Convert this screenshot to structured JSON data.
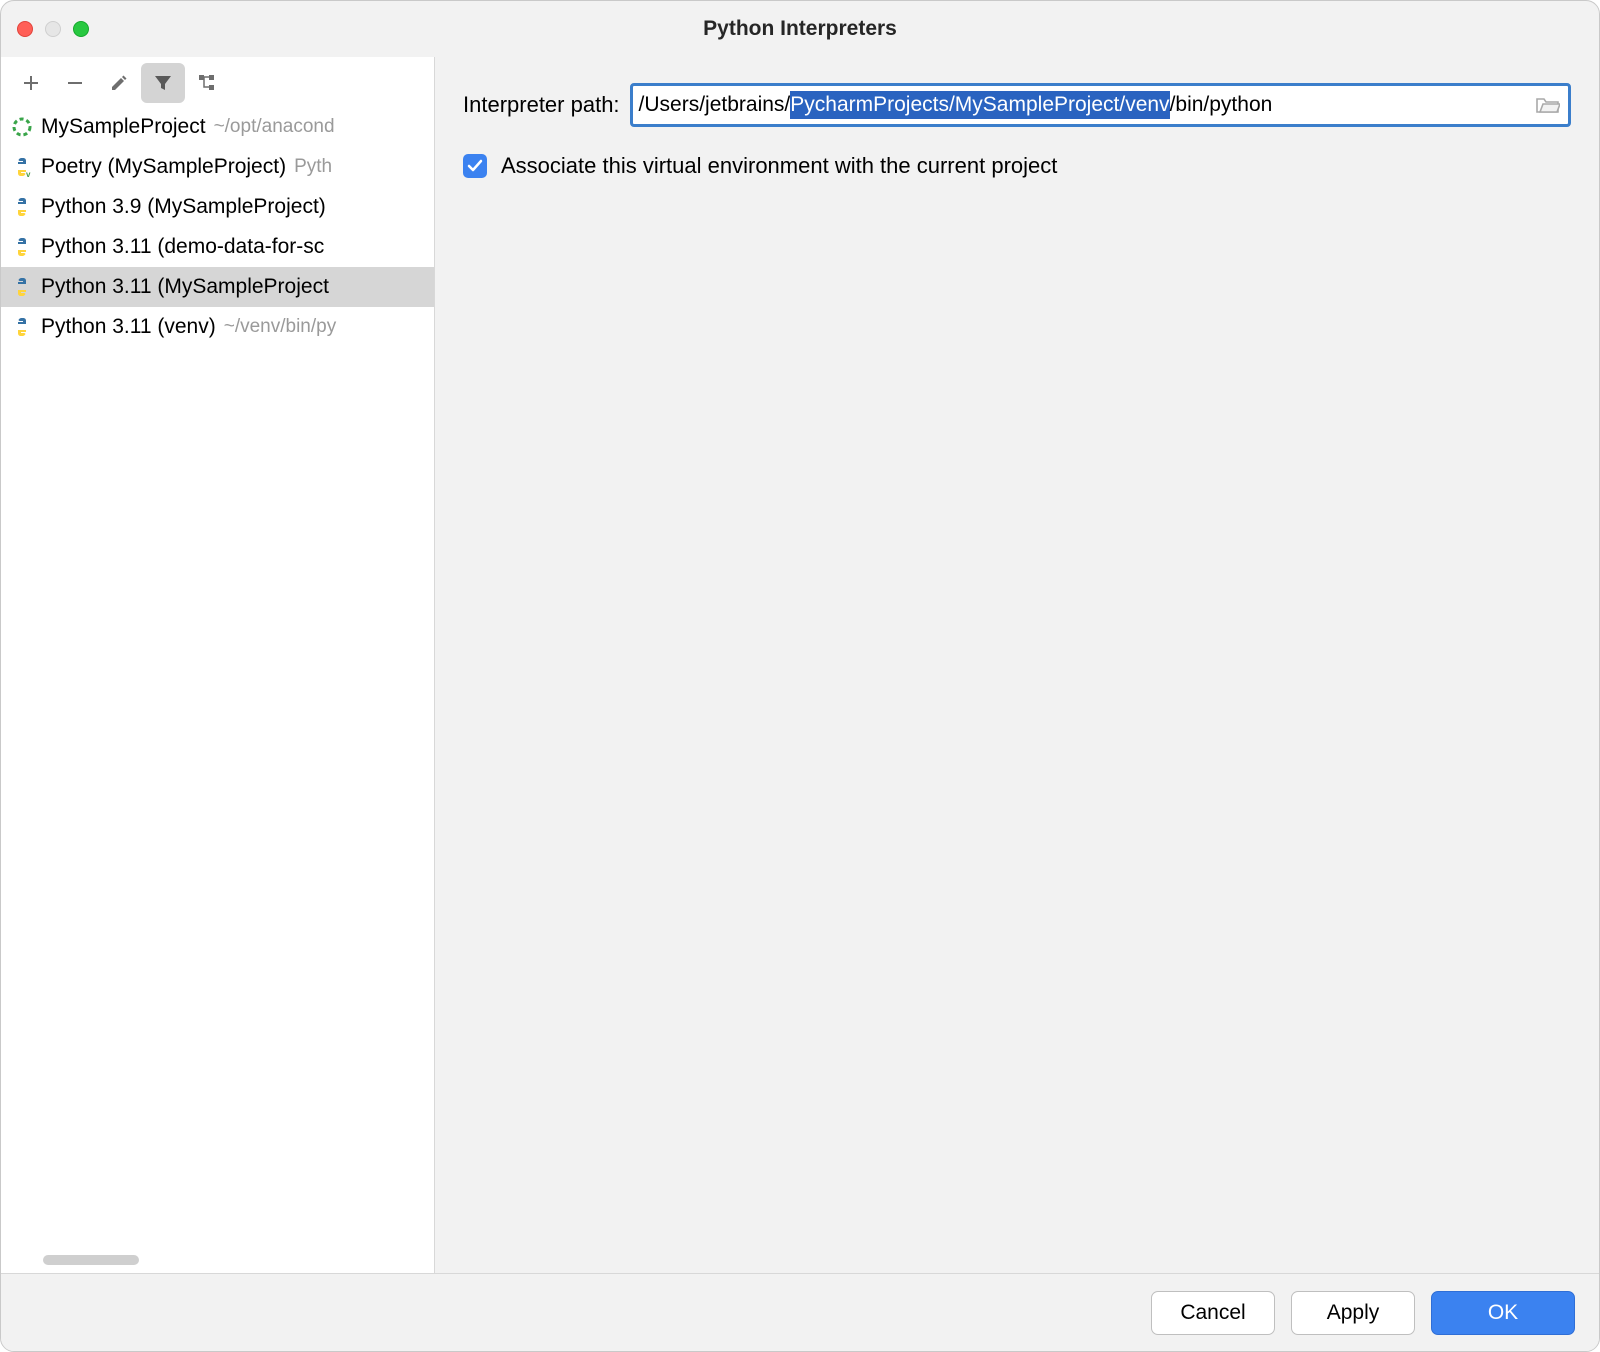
{
  "window": {
    "title": "Python Interpreters"
  },
  "toolbar": {
    "add": "add-icon",
    "remove": "minus-icon",
    "edit": "pencil-icon",
    "filter": "filter-icon",
    "tree": "tree-icon"
  },
  "interpreters": {
    "items": [
      {
        "icon": "conda",
        "name": "MySampleProject",
        "suffix": "~/opt/anacond",
        "selected": false
      },
      {
        "icon": "python-v",
        "name": "Poetry (MySampleProject)",
        "suffix": "Pyth",
        "selected": false
      },
      {
        "icon": "python",
        "name": "Python 3.9 (MySampleProject)",
        "suffix": "",
        "selected": false
      },
      {
        "icon": "python",
        "name": "Python 3.11 (demo-data-for-sc",
        "suffix": "",
        "selected": false
      },
      {
        "icon": "python",
        "name": "Python 3.11 (MySampleProject",
        "suffix": "",
        "selected": true
      },
      {
        "icon": "python",
        "name": "Python 3.11 (venv)",
        "suffix": "~/venv/bin/py",
        "selected": false
      }
    ]
  },
  "main": {
    "path_label": "Interpreter path:",
    "path_pre": "/Users/jetbrains/",
    "path_sel": "PycharmProjects/MySampleProject/venv",
    "path_post": "/bin/python",
    "associate_label": "Associate this virtual environment with the current project",
    "associate_checked": true
  },
  "footer": {
    "cancel": "Cancel",
    "apply": "Apply",
    "ok": "OK"
  }
}
